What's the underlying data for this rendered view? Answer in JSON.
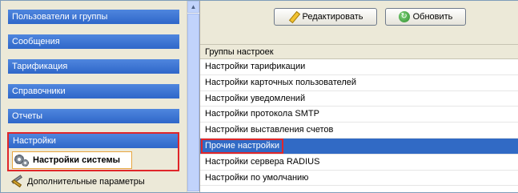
{
  "sidebar": {
    "sections": [
      {
        "label": "Пользователи и группы"
      },
      {
        "label": "Сообщения"
      },
      {
        "label": "Тарификация"
      },
      {
        "label": "Справочники"
      },
      {
        "label": "Отчеты"
      }
    ],
    "settings_section": {
      "label": "Настройки"
    },
    "settings_items": [
      {
        "label": "Настройки системы",
        "icon": "gear-icon",
        "selected": true
      },
      {
        "label": "Дополнительные параметры",
        "icon": "tools-icon"
      }
    ]
  },
  "toolbar": {
    "edit_label": "Редактировать",
    "refresh_label": "Обновить"
  },
  "table": {
    "header": "Группы настроек",
    "rows": [
      "Настройки тарификации",
      "Настройки карточных пользователей",
      "Настройки уведомлений",
      "Настройки протокола SMTP",
      "Настройки выставления счетов",
      "Прочие настройки",
      "Настройки сервера RADIUS",
      "Настройки по умолчанию"
    ],
    "selected_index": 5
  },
  "colors": {
    "section_blue": "#3a73d6",
    "selection_blue": "#316ac5",
    "highlight_red": "#e0262a",
    "panel_bg": "#ece9d8"
  }
}
